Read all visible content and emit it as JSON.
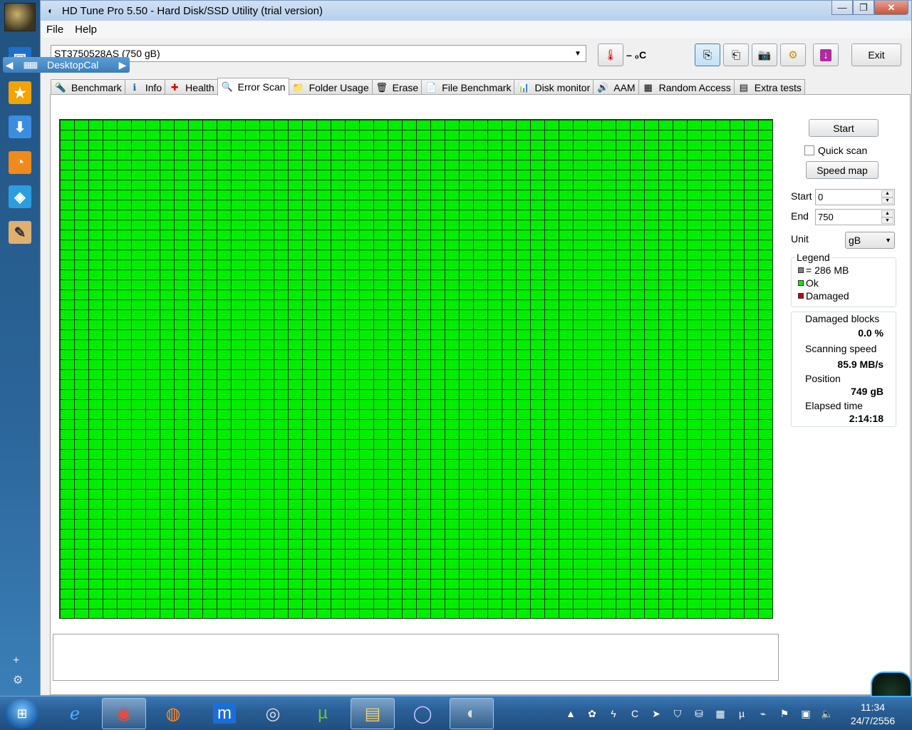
{
  "desktop": {
    "desktopcal_label": "DesktopCal"
  },
  "window": {
    "title": "HD Tune Pro 5.50 - Hard Disk/SSD Utility (trial version)",
    "controls": {
      "minimize": "—",
      "maximize": "❐",
      "close": "✕"
    }
  },
  "menu": {
    "file": "File",
    "help": "Help"
  },
  "toolbar": {
    "drive": "ST3750528AS (750 gB)",
    "temperature": "– ₀C",
    "exit_label": "Exit"
  },
  "tabs": [
    {
      "label": "Benchmark",
      "icon": "benchmark-icon"
    },
    {
      "label": "Info",
      "icon": "info-icon"
    },
    {
      "label": "Health",
      "icon": "health-icon"
    },
    {
      "label": "Error Scan",
      "icon": "error-scan-icon",
      "active": true
    },
    {
      "label": "Folder Usage",
      "icon": "folder-icon"
    },
    {
      "label": "Erase",
      "icon": "erase-icon"
    },
    {
      "label": "File Benchmark",
      "icon": "file-benchmark-icon"
    },
    {
      "label": "Disk monitor",
      "icon": "disk-monitor-icon"
    },
    {
      "label": "AAM",
      "icon": "speaker-icon"
    },
    {
      "label": "Random Access",
      "icon": "random-access-icon"
    },
    {
      "label": "Extra tests",
      "icon": "extra-tests-icon"
    }
  ],
  "scan": {
    "start_button": "Start",
    "quick_scan_label": "Quick scan",
    "quick_scan_checked": false,
    "speed_map_button": "Speed map",
    "start_label": "Start",
    "start_value": "0",
    "end_label": "End",
    "end_value": "750",
    "unit_label": "Unit",
    "unit_value": "gB",
    "block_color_ok": "#00ee00",
    "block_color_damaged": "#cc0000"
  },
  "legend": {
    "title": "Legend",
    "block_size": "= 286 MB",
    "ok": "Ok",
    "damaged": "Damaged"
  },
  "stats": {
    "damaged_blocks_label": "Damaged blocks",
    "damaged_blocks_value": "0.0 %",
    "scanning_speed_label": "Scanning speed",
    "scanning_speed_value": "85.9 MB/s",
    "position_label": "Position",
    "position_value": "749 gB",
    "elapsed_label": "Elapsed time",
    "elapsed_value": "2:14:18"
  },
  "taskbar": {
    "time": "11:34",
    "date": "24/7/2556"
  }
}
